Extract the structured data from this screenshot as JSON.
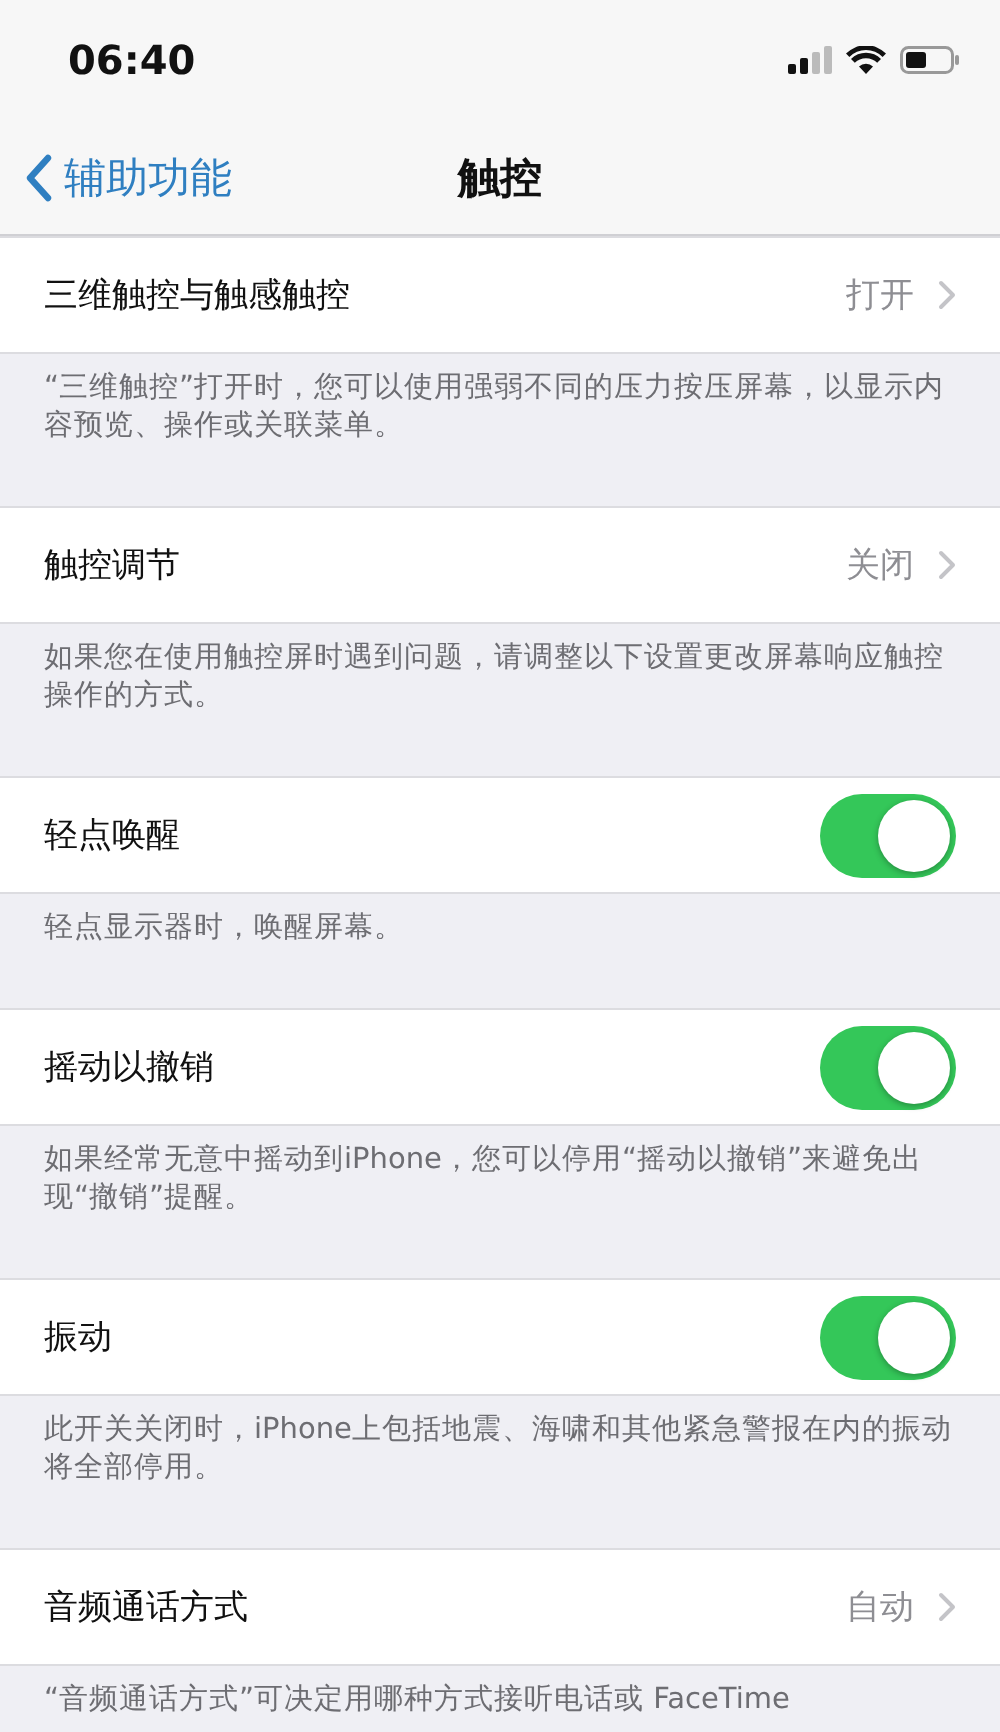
{
  "status_bar": {
    "time": "06:40"
  },
  "nav": {
    "back": "辅助功能",
    "title": "触控"
  },
  "sections": [
    {
      "kind": "link",
      "label": "三维触控与触感触控",
      "value": "打开",
      "footer": "“三维触控”打开时，您可以使用强弱不同的压力按压屏幕，以显示内容预览、操作或关联菜单。"
    },
    {
      "kind": "link",
      "label": "触控调节",
      "value": "关闭",
      "footer": "如果您在使用触控屏时遇到问题，请调整以下设置更改屏幕响应触控操作的方式。"
    },
    {
      "kind": "toggle",
      "label": "轻点唤醒",
      "on": true,
      "footer": "轻点显示器时，唤醒屏幕。"
    },
    {
      "kind": "toggle",
      "label": "摇动以撤销",
      "on": true,
      "footer": "如果经常无意中摇动到iPhone，您可以停用“摇动以撤销”来避免出现“撤销”提醒。"
    },
    {
      "kind": "toggle",
      "label": "振动",
      "on": true,
      "footer": "此开关关闭时，iPhone上包括地震、海啸和其他紧急警报在内的振动将全部停用。"
    },
    {
      "kind": "link",
      "label": "音频通话方式",
      "value": "自动",
      "footer": "“音频通话方式”可决定用哪种方式接听电话或 FaceTime"
    }
  ]
}
